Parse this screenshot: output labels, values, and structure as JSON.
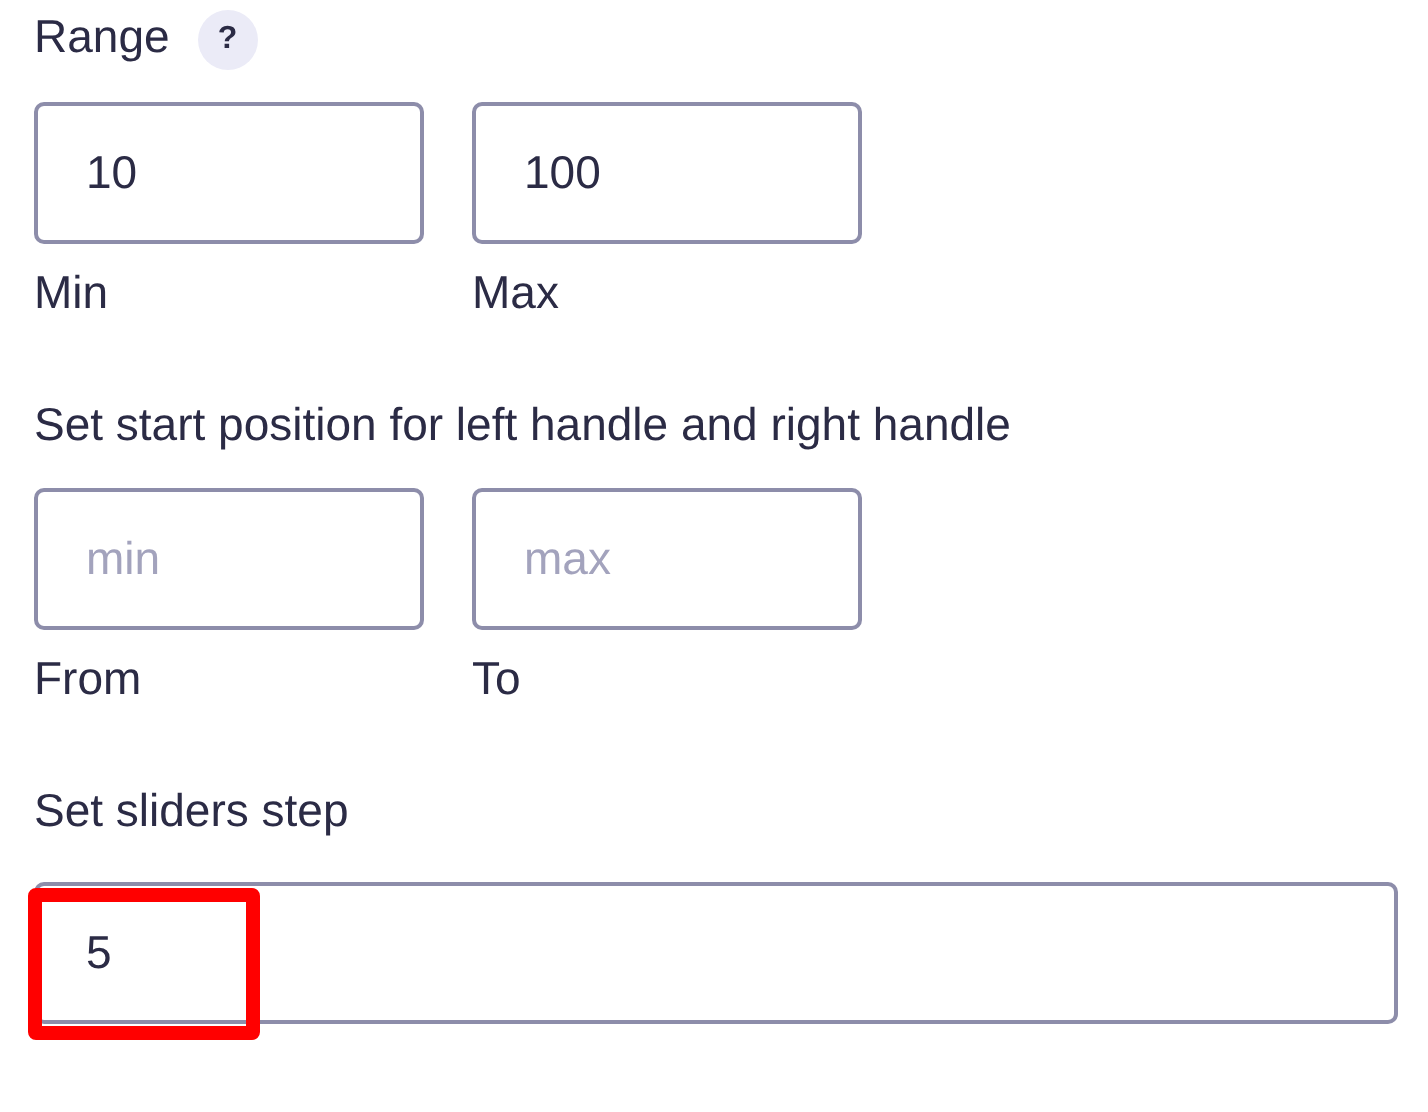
{
  "range": {
    "title": "Range",
    "help": "?",
    "fields": [
      {
        "value": "10",
        "caption": "Min"
      },
      {
        "value": "100",
        "caption": "Max"
      }
    ]
  },
  "start": {
    "title": "Set start position for left handle and right handle",
    "fields": [
      {
        "placeholder": "min",
        "caption": "From"
      },
      {
        "placeholder": "max",
        "caption": "To"
      }
    ]
  },
  "step": {
    "title": "Set sliders step",
    "value": "5",
    "highlighted": true
  }
}
